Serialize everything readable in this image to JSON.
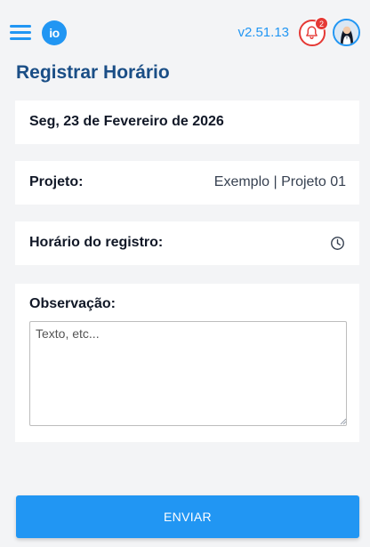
{
  "header": {
    "menu_icon": "hamburger-menu-icon",
    "logo_text": "io",
    "version": "v2.51.13",
    "notifications": {
      "icon": "bell-icon",
      "count": "2"
    },
    "avatar": {
      "icon": "user-avatar"
    }
  },
  "page": {
    "title": "Registrar Horário"
  },
  "date_card": {
    "value": "Seg, 23 de Fevereiro de 2026"
  },
  "project_card": {
    "label": "Projeto:",
    "value": "Exemplo | Projeto 01"
  },
  "time_card": {
    "label": "Horário do registro:",
    "icon": "clock-icon"
  },
  "observation": {
    "label": "Observação:",
    "placeholder": "Texto, etc...",
    "value": ""
  },
  "submit": {
    "label": "ENVIAR"
  },
  "colors": {
    "primary": "#2196f3",
    "title": "#1a4e86",
    "alert": "#e53935",
    "background": "#f3f4f6",
    "card": "#ffffff"
  }
}
